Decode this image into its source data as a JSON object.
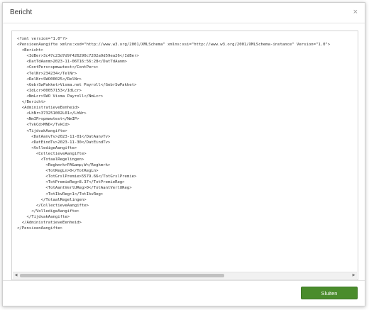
{
  "dialog": {
    "title": "Bericht",
    "close_label": "×",
    "xml_lines": [
      "<?xml version=\"1.0\"?>",
      "<PensioenAangifte xmlns:xsd=\"http://www.w3.org/2001/XMLSchema\" xmlns:xsi=\"http://www.w3.org/2001/XMLSchema-instance\" Version=\"1.0\">",
      "  <Bericht>",
      "    <IdBer>3c47c23d7d9f426290c7202a9d59ea26</IdBer>",
      "    <DatTdAanm>2023-11-06T16:56:28</DatTdAanm>",
      "    <ContPers>spmwwtest</ContPers>",
      "    <TelNr>234234</TelNr>",
      "    <RelNr>SWO00025</RelNr>",
      "    <GebrSwPakket>Visma.net Payroll</GebrSwPakket>",
      "    <IdLcr>00057153</IdLcr>",
      "    <NmLcr>SWO Visma Payroll</NmLcr>",
      "  </Bericht>",
      "  <AdministratieveEenheid>",
      "    <LhNr>373251002L01</LhNr>",
      "    <NmIP>spmwwtest</NmIP>",
      "    <TvkCd>MND</TvkCd>",
      "    <TijdvakAangifte>",
      "      <DatAanvTv>2023-11-01</DatAanvTv>",
      "      <DatEindTv>2023-11-30</DatEindTv>",
      "      <VolledigeAangifte>",
      "        <CollectieveAangifte>",
      "          <TotaalRegelingen>",
      "            <Regkmrk>PA&amp;W</Regkmrk>",
      "            <TotRegLn>0</TotRegLn>",
      "            <TotGrslPremie>5579.66</TotGrslPremie>",
      "            <TotPremieReg>8.37</TotPremieReg>",
      "            <TotAantVerlUReg>0</TotAantVerlUReg>",
      "            <TotIkvReg>1</TotIkvReg>",
      "          </TotaalRegelingen>",
      "        </CollectieveAangifte>",
      "      </VolledigeAangifte>",
      "    </TijdvakAangifte>",
      "  </AdministratieveEenheid>",
      "</PensioenAangifte>"
    ],
    "close_button_label": "Sluiten"
  },
  "icons": {
    "close": "close-icon",
    "scroll_left": "scroll-left-arrow-icon",
    "scroll_right": "scroll-right-arrow-icon"
  },
  "colors": {
    "primary_button": "#4a8c2c"
  }
}
